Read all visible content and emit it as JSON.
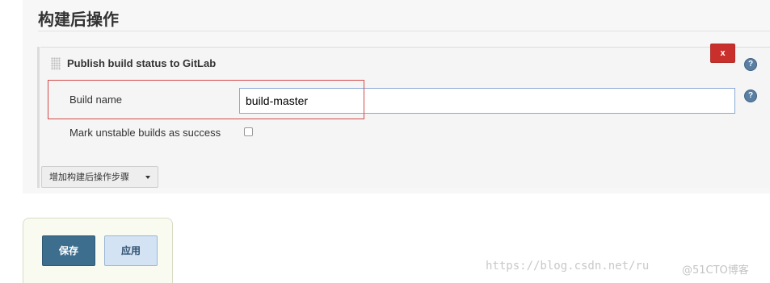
{
  "section": {
    "title": "构建后操作"
  },
  "publisher": {
    "title": "Publish build status to GitLab",
    "delete_label": "x",
    "help_label": "?",
    "build_name_label": "Build name",
    "build_name_value": "build-master",
    "unstable_label": "Mark unstable builds as success",
    "unstable_checked": false
  },
  "add_step": {
    "label": "增加构建后操作步骤"
  },
  "actions": {
    "save_label": "保存",
    "apply_label": "应用"
  },
  "watermark": {
    "url": "https://blog.csdn.net/ru",
    "brand": "@51CTO博客"
  },
  "colors": {
    "delete": "#c9302c",
    "save": "#3e6e8e",
    "apply": "#d4e3f3",
    "highlight": "#d44a4a",
    "input_border": "#8aa8d6"
  },
  "icons": {
    "help": "help-icon",
    "drag": "drag-handle-icon",
    "dropdown": "caret-down-icon"
  }
}
